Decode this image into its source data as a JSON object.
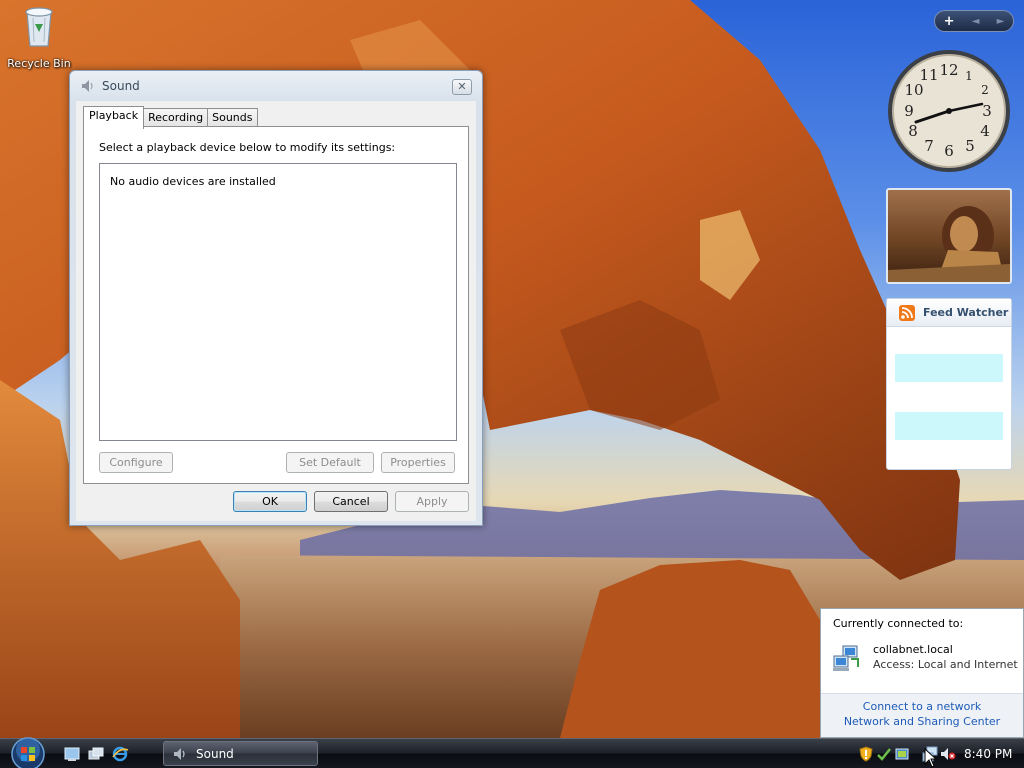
{
  "desktop": {
    "recycle_bin_label": "Recycle Bin"
  },
  "gadgets": {
    "toolbar": {
      "add": "+",
      "prev": "◄",
      "next": "►"
    },
    "clock": {
      "numerals": [
        "12",
        "1",
        "2",
        "3",
        "4",
        "5",
        "6",
        "7",
        "8",
        "9",
        "10",
        "11"
      ]
    },
    "feed": {
      "title": "Feed Watcher"
    }
  },
  "dialog": {
    "title": "Sound",
    "close_glyph": "✕",
    "tabs": [
      {
        "label": "Playback",
        "active": true
      },
      {
        "label": "Recording",
        "active": false
      },
      {
        "label": "Sounds",
        "active": false
      }
    ],
    "instruction": "Select a playback device below to modify its settings:",
    "empty_message": "No audio devices are installed",
    "buttons": {
      "configure": "Configure",
      "set_default": "Set Default",
      "properties": "Properties",
      "ok": "OK",
      "cancel": "Cancel",
      "apply": "Apply"
    }
  },
  "network_popup": {
    "heading": "Currently connected to:",
    "network_name": "collabnet.local",
    "access": "Access:  Local and Internet",
    "link_connect": "Connect to a network",
    "link_center": "Network and Sharing Center"
  },
  "taskbar": {
    "task_label": "Sound",
    "time": "8:40 PM"
  },
  "colors": {
    "link": "#1e5bb7",
    "feed_highlight": "#ccf7fb"
  }
}
